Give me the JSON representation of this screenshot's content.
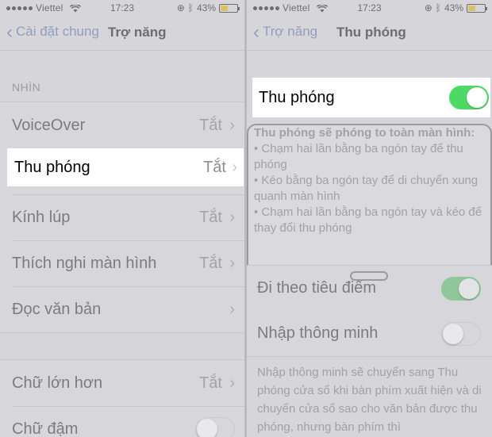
{
  "status_bar": {
    "carrier": "Viettel",
    "time": "17:23",
    "battery": "43%"
  },
  "left": {
    "back_label": "Cài đặt chung",
    "title": "Trợ năng",
    "section_header": "NHÌN",
    "rows": [
      {
        "label": "VoiceOver",
        "value": "Tắt"
      },
      {
        "label": "Thu phóng",
        "value": "Tắt"
      },
      {
        "label": "Kính lúp",
        "value": "Tắt"
      },
      {
        "label": "Thích nghi màn hình",
        "value": "Tắt"
      },
      {
        "label": "Đọc văn bản",
        "value": ""
      }
    ],
    "rows2": [
      {
        "label": "Chữ lớn hơn",
        "value": "Tắt"
      },
      {
        "label": "Chữ đậm",
        "value": ""
      }
    ]
  },
  "right": {
    "back_label": "Trợ năng",
    "title": "Thu phóng",
    "zoom_label": "Thu phóng",
    "zoom_on": true,
    "desc_title": "Thu phóng sẽ phóng to toàn màn hình:",
    "desc_items": [
      "• Chạm hai lần bằng ba ngón tay để thu phóng",
      "• Kéo bằng ba ngón tay để di chuyển xung quanh màn hình",
      "• Chạm hai lần bằng ba ngón tay và kéo để thay đổi thu phóng"
    ],
    "follow_focus_label": "Đi theo tiêu điểm",
    "follow_focus_on": true,
    "smart_typing_label": "Nhập thông minh",
    "smart_typing_on": false,
    "footer": "Nhập thông minh sẽ chuyển sang Thu phóng cửa sổ khi bàn phím xuất hiện và di chuyển cửa sổ sao cho văn bản được thu phóng, nhưng bàn phím thì"
  }
}
